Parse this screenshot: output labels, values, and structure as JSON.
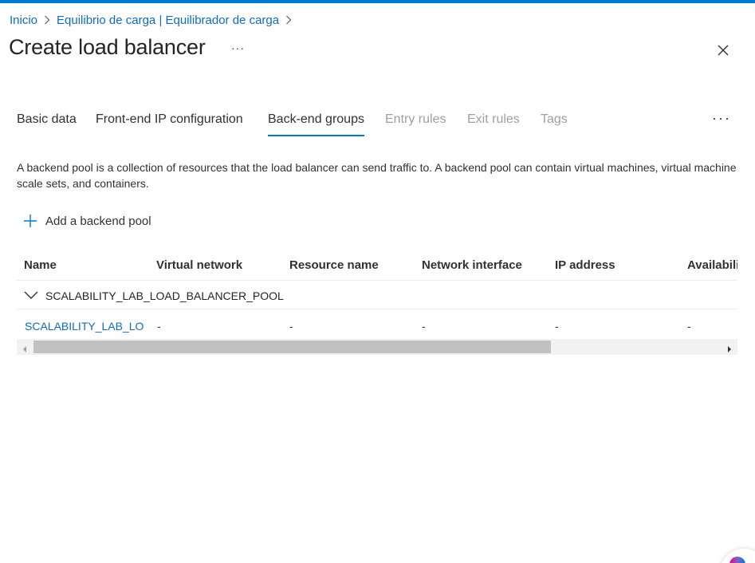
{
  "breadcrumb": {
    "items": [
      "Inicio",
      "Equilibrio de carga | Equilibrador de carga"
    ]
  },
  "page": {
    "title": "Create load balancer",
    "more_label": "···"
  },
  "tabs": [
    {
      "label": "Basic data",
      "state": "normal"
    },
    {
      "label": "Front-end IP configuration",
      "state": "normal"
    },
    {
      "label": "Back-end groups",
      "state": "active"
    },
    {
      "label": "Entry rules",
      "state": "disabled"
    },
    {
      "label": "Exit rules",
      "state": "disabled"
    },
    {
      "label": "Tags",
      "state": "disabled"
    }
  ],
  "tabs_more_label": "···",
  "description": "A backend pool is a collection of resources that the load balancer can send traffic to. A backend pool can contain virtual machines, virtual machine scale sets, and containers.",
  "add_pool": {
    "label": "Add a backend pool",
    "icon": "plus-icon"
  },
  "table": {
    "columns": [
      "Name",
      "Virtual network",
      "Resource name",
      "Network interface",
      "IP address",
      "Availabilit"
    ],
    "group": {
      "label": "SCALABILITY_LAB_LOAD_BALANCER_POOL",
      "expanded": true
    },
    "rows": [
      {
        "name": "SCALABILITY_LAB_LO···",
        "virtual_network": "-",
        "resource_name": "-",
        "network_interface": "-",
        "ip_address": "-",
        "availability": "-"
      }
    ]
  },
  "colors": {
    "accent": "#0078d4",
    "link": "#0f6cbd",
    "disabled_text": "#a19f9d"
  }
}
